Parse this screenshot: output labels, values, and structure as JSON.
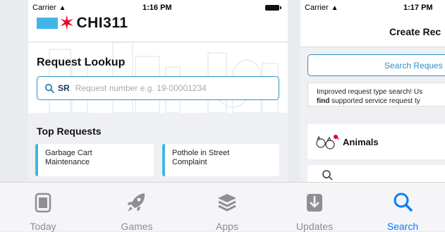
{
  "phone1": {
    "status": {
      "carrier": "Carrier",
      "time": "1:16 PM"
    },
    "logo_text": "CHI311",
    "lookup_title": "Request Lookup",
    "search_prefix": "SR",
    "search_placeholder": "Request number e.g. 19-00001234",
    "top_requests_title": "Top Requests",
    "top_requests": [
      {
        "line1": "Garbage Cart",
        "line2": "Maintenance"
      },
      {
        "line1": "Pothole in Street",
        "line2": "Complaint"
      }
    ]
  },
  "phone2": {
    "status": {
      "carrier": "Carrier",
      "time": "1:17 PM"
    },
    "title": "Create Rec",
    "search_button": "Search Reques",
    "info_line1": "Improved request type search! Us",
    "info_bold": "find",
    "info_line2_rest": " supported service request ty",
    "category": "Animals"
  },
  "tabbar": {
    "tabs": [
      {
        "label": "Today",
        "icon": "today-icon"
      },
      {
        "label": "Games",
        "icon": "rocket-icon"
      },
      {
        "label": "Apps",
        "icon": "layers-icon"
      },
      {
        "label": "Updates",
        "icon": "download-icon"
      },
      {
        "label": "Search",
        "icon": "search-icon"
      }
    ],
    "active": "Search"
  },
  "colors": {
    "accent": "#0a7cff",
    "chicago_blue": "#41b6e6",
    "chicago_red": "#e4002b",
    "inactive": "#8e8e93"
  }
}
